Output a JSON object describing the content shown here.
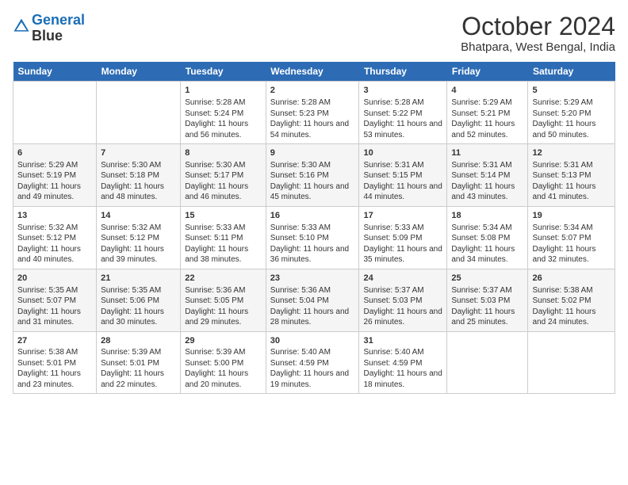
{
  "logo": {
    "line1": "General",
    "line2": "Blue"
  },
  "title": "October 2024",
  "location": "Bhatpara, West Bengal, India",
  "days_of_week": [
    "Sunday",
    "Monday",
    "Tuesday",
    "Wednesday",
    "Thursday",
    "Friday",
    "Saturday"
  ],
  "weeks": [
    [
      {
        "num": "",
        "info": ""
      },
      {
        "num": "",
        "info": ""
      },
      {
        "num": "1",
        "info": "Sunrise: 5:28 AM\nSunset: 5:24 PM\nDaylight: 11 hours and 56 minutes."
      },
      {
        "num": "2",
        "info": "Sunrise: 5:28 AM\nSunset: 5:23 PM\nDaylight: 11 hours and 54 minutes."
      },
      {
        "num": "3",
        "info": "Sunrise: 5:28 AM\nSunset: 5:22 PM\nDaylight: 11 hours and 53 minutes."
      },
      {
        "num": "4",
        "info": "Sunrise: 5:29 AM\nSunset: 5:21 PM\nDaylight: 11 hours and 52 minutes."
      },
      {
        "num": "5",
        "info": "Sunrise: 5:29 AM\nSunset: 5:20 PM\nDaylight: 11 hours and 50 minutes."
      }
    ],
    [
      {
        "num": "6",
        "info": "Sunrise: 5:29 AM\nSunset: 5:19 PM\nDaylight: 11 hours and 49 minutes."
      },
      {
        "num": "7",
        "info": "Sunrise: 5:30 AM\nSunset: 5:18 PM\nDaylight: 11 hours and 48 minutes."
      },
      {
        "num": "8",
        "info": "Sunrise: 5:30 AM\nSunset: 5:17 PM\nDaylight: 11 hours and 46 minutes."
      },
      {
        "num": "9",
        "info": "Sunrise: 5:30 AM\nSunset: 5:16 PM\nDaylight: 11 hours and 45 minutes."
      },
      {
        "num": "10",
        "info": "Sunrise: 5:31 AM\nSunset: 5:15 PM\nDaylight: 11 hours and 44 minutes."
      },
      {
        "num": "11",
        "info": "Sunrise: 5:31 AM\nSunset: 5:14 PM\nDaylight: 11 hours and 43 minutes."
      },
      {
        "num": "12",
        "info": "Sunrise: 5:31 AM\nSunset: 5:13 PM\nDaylight: 11 hours and 41 minutes."
      }
    ],
    [
      {
        "num": "13",
        "info": "Sunrise: 5:32 AM\nSunset: 5:12 PM\nDaylight: 11 hours and 40 minutes."
      },
      {
        "num": "14",
        "info": "Sunrise: 5:32 AM\nSunset: 5:12 PM\nDaylight: 11 hours and 39 minutes."
      },
      {
        "num": "15",
        "info": "Sunrise: 5:33 AM\nSunset: 5:11 PM\nDaylight: 11 hours and 38 minutes."
      },
      {
        "num": "16",
        "info": "Sunrise: 5:33 AM\nSunset: 5:10 PM\nDaylight: 11 hours and 36 minutes."
      },
      {
        "num": "17",
        "info": "Sunrise: 5:33 AM\nSunset: 5:09 PM\nDaylight: 11 hours and 35 minutes."
      },
      {
        "num": "18",
        "info": "Sunrise: 5:34 AM\nSunset: 5:08 PM\nDaylight: 11 hours and 34 minutes."
      },
      {
        "num": "19",
        "info": "Sunrise: 5:34 AM\nSunset: 5:07 PM\nDaylight: 11 hours and 32 minutes."
      }
    ],
    [
      {
        "num": "20",
        "info": "Sunrise: 5:35 AM\nSunset: 5:07 PM\nDaylight: 11 hours and 31 minutes."
      },
      {
        "num": "21",
        "info": "Sunrise: 5:35 AM\nSunset: 5:06 PM\nDaylight: 11 hours and 30 minutes."
      },
      {
        "num": "22",
        "info": "Sunrise: 5:36 AM\nSunset: 5:05 PM\nDaylight: 11 hours and 29 minutes."
      },
      {
        "num": "23",
        "info": "Sunrise: 5:36 AM\nSunset: 5:04 PM\nDaylight: 11 hours and 28 minutes."
      },
      {
        "num": "24",
        "info": "Sunrise: 5:37 AM\nSunset: 5:03 PM\nDaylight: 11 hours and 26 minutes."
      },
      {
        "num": "25",
        "info": "Sunrise: 5:37 AM\nSunset: 5:03 PM\nDaylight: 11 hours and 25 minutes."
      },
      {
        "num": "26",
        "info": "Sunrise: 5:38 AM\nSunset: 5:02 PM\nDaylight: 11 hours and 24 minutes."
      }
    ],
    [
      {
        "num": "27",
        "info": "Sunrise: 5:38 AM\nSunset: 5:01 PM\nDaylight: 11 hours and 23 minutes."
      },
      {
        "num": "28",
        "info": "Sunrise: 5:39 AM\nSunset: 5:01 PM\nDaylight: 11 hours and 22 minutes."
      },
      {
        "num": "29",
        "info": "Sunrise: 5:39 AM\nSunset: 5:00 PM\nDaylight: 11 hours and 20 minutes."
      },
      {
        "num": "30",
        "info": "Sunrise: 5:40 AM\nSunset: 4:59 PM\nDaylight: 11 hours and 19 minutes."
      },
      {
        "num": "31",
        "info": "Sunrise: 5:40 AM\nSunset: 4:59 PM\nDaylight: 11 hours and 18 minutes."
      },
      {
        "num": "",
        "info": ""
      },
      {
        "num": "",
        "info": ""
      }
    ]
  ]
}
